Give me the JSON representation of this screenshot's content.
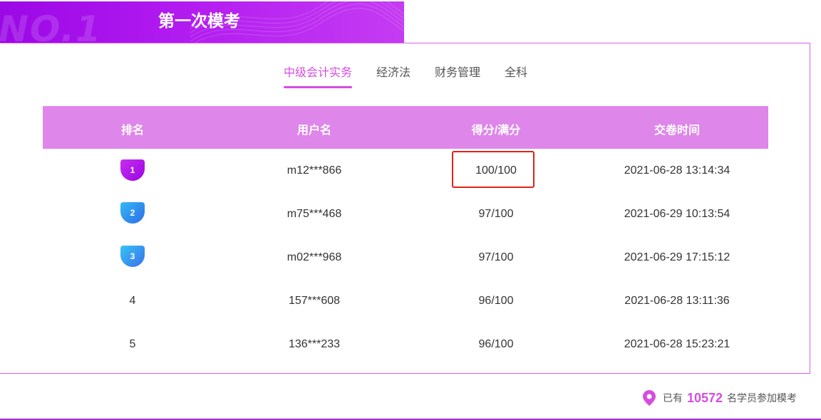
{
  "banner": {
    "deco_text": "NO.1",
    "title": "第一次模考",
    "color": "#a80ce8"
  },
  "tabs": [
    {
      "label": "中级会计实务",
      "active": true
    },
    {
      "label": "经济法",
      "active": false
    },
    {
      "label": "财务管理",
      "active": false
    },
    {
      "label": "全科",
      "active": false
    }
  ],
  "table": {
    "headers": [
      "排名",
      "用户名",
      "得分/满分",
      "交卷时间"
    ],
    "rows": [
      {
        "rank": "1",
        "user": "m12***866",
        "score": "100/100",
        "time": "2021-06-28 13:14:34"
      },
      {
        "rank": "2",
        "user": "m75***468",
        "score": "97/100",
        "time": "2021-06-29 10:13:54"
      },
      {
        "rank": "3",
        "user": "m02***968",
        "score": "97/100",
        "time": "2021-06-29 17:15:12"
      },
      {
        "rank": "4",
        "user": "157***608",
        "score": "96/100",
        "time": "2021-06-28 13:11:36"
      },
      {
        "rank": "5",
        "user": "136***233",
        "score": "96/100",
        "time": "2021-06-28 15:23:21"
      }
    ]
  },
  "footer": {
    "prefix": "已有",
    "count": "10572",
    "suffix": "名学员参加模考",
    "icon": "location-pin-icon"
  },
  "colors": {
    "accent": "#d54de0",
    "header_bg": "#de86ea",
    "highlight": "#e0221a"
  }
}
